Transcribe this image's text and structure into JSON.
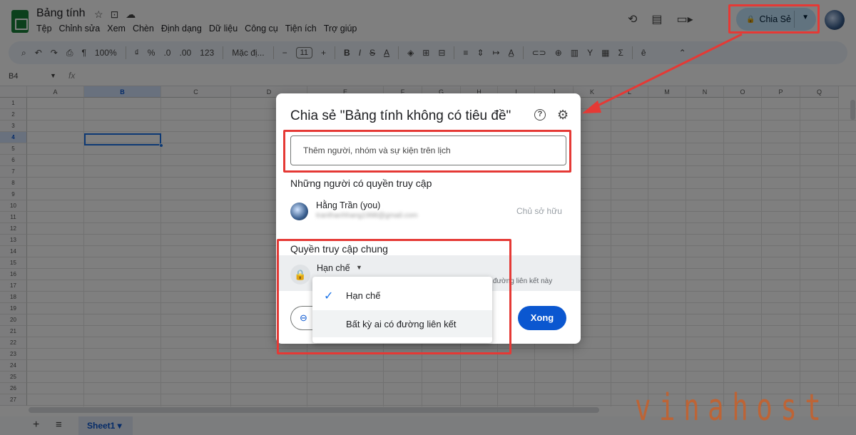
{
  "header": {
    "doc_title": "Bảng tính",
    "title_icons": [
      "star-icon",
      "folder-move-icon",
      "cloud-status-icon"
    ],
    "menu": [
      "Tệp",
      "Chỉnh sửa",
      "Xem",
      "Chèn",
      "Định dạng",
      "Dữ liệu",
      "Công cụ",
      "Tiện ích",
      "Trợ giúp"
    ],
    "share_label": "Chia Sẻ",
    "lock_glyph": "🔒"
  },
  "toolbar": {
    "zoom": "100%",
    "currency": "₫",
    "percent": "%",
    "dec_less": ".0",
    "dec_more": ".00",
    "number_format": "123",
    "font": "Mặc đị...",
    "font_size": "11",
    "bold": "B",
    "italic": "I",
    "strike": "S",
    "text_color": "A",
    "sum": "Σ"
  },
  "formula_bar": {
    "name_box": "B4",
    "fx": "fx"
  },
  "grid": {
    "columns": [
      "A",
      "B",
      "C",
      "D",
      "E",
      "F",
      "G",
      "H",
      "I",
      "J",
      "K",
      "L",
      "M",
      "N",
      "O",
      "P",
      "Q"
    ],
    "selected_column": "B",
    "rows": [
      "1",
      "2",
      "3",
      "4",
      "5",
      "6",
      "7",
      "8",
      "9",
      "10",
      "11",
      "12",
      "13",
      "14",
      "15",
      "16",
      "17",
      "18",
      "19",
      "20",
      "21",
      "22",
      "23",
      "24",
      "25",
      "26",
      "27"
    ],
    "selected_row": "4"
  },
  "dialog": {
    "title": "Chia sẻ \"Bảng tính không có tiêu đề\"",
    "help_glyph": "?",
    "gear_glyph": "⚙",
    "add_placeholder": "Thêm người, nhóm và sự kiện trên lịch",
    "access_heading": "Những người có quyền truy cập",
    "owner_name": "Hằng Trần (you)",
    "owner_email": "tranthanhhang1998@gmail.com",
    "owner_role": "Chủ sở hữu",
    "general_heading": "Quyền truy cập chung",
    "general_value": "Hạn chế",
    "general_desc": "ng đường liên kết này",
    "copy_link_glyph": "⊖",
    "done_label": "Xong"
  },
  "dropdown": {
    "options": [
      {
        "label": "Hạn chế",
        "selected": true
      },
      {
        "label": "Bất kỳ ai có đường liên kết",
        "selected": false
      }
    ],
    "check_glyph": "✓"
  },
  "footer": {
    "add_sheet": "+",
    "all_sheets": "≡",
    "sheet_tab": "Sheet1 ▾"
  },
  "watermark": "vinahost",
  "annotation_color": "#e53935"
}
